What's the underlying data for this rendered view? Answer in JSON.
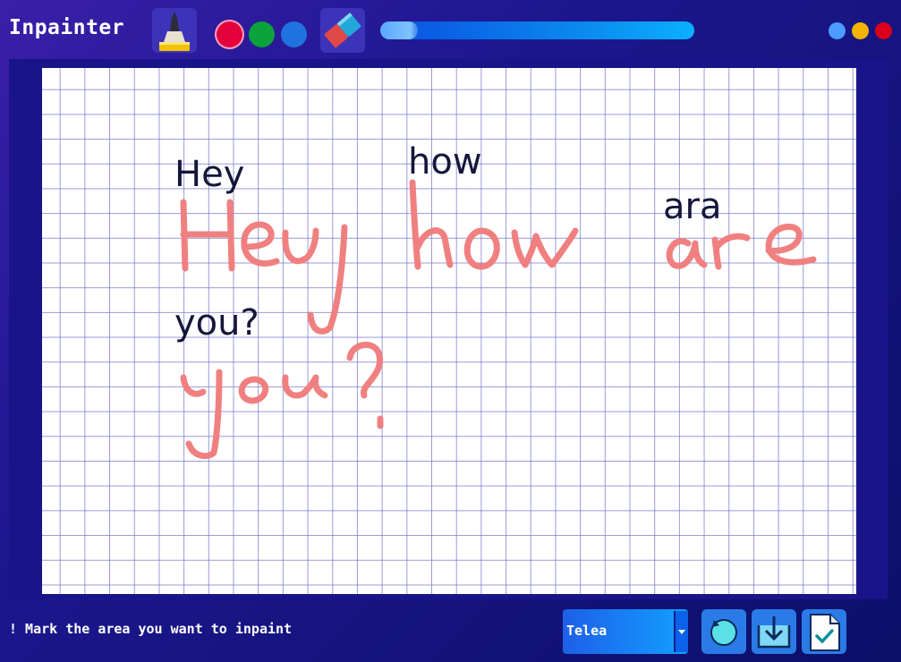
{
  "app": {
    "title": "Inpainter"
  },
  "toolbar": {
    "brush_icon": "brush-icon",
    "eraser_icon": "eraser-icon",
    "colors": [
      "#e4003b",
      "#0ba33b",
      "#1f73e0"
    ],
    "brush_size_fraction": 0.06
  },
  "window_controls": [
    "#4c9bff",
    "#f2b400",
    "#d8001c"
  ],
  "canvas": {
    "typed_words": [
      "Hey",
      "how",
      "ara",
      "you?"
    ],
    "handwritten_text": "Hey how are you?",
    "mask_color": "#f08080"
  },
  "status": {
    "message": "! Mark the area you want to inpaint"
  },
  "method_select": {
    "selected": "Telea"
  },
  "actions": {
    "reset_icon": "reset-icon",
    "save_icon": "save-icon",
    "apply_icon": "apply-icon"
  }
}
